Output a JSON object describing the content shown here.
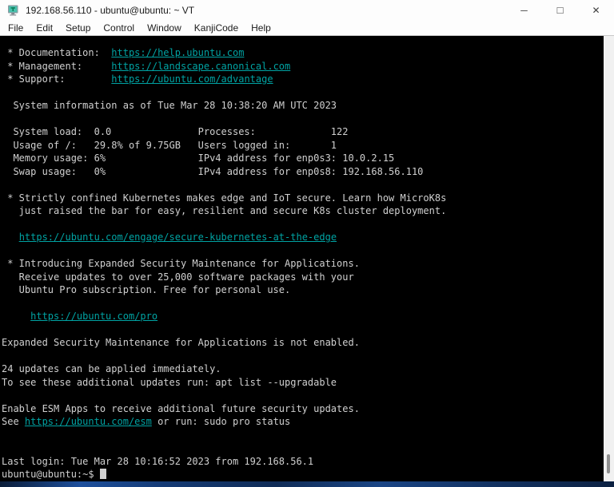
{
  "window": {
    "title": "192.168.56.110 - ubuntu@ubuntu: ~ VT",
    "app_icon": "tera-term-icon",
    "controls": [
      {
        "id": "minimize",
        "glyph": "─"
      },
      {
        "id": "maximize",
        "glyph": "□"
      },
      {
        "id": "close",
        "glyph": "✕"
      }
    ]
  },
  "menu_bar": {
    "items": [
      {
        "label": "File"
      },
      {
        "label": "Edit"
      },
      {
        "label": "Setup"
      },
      {
        "label": "Control"
      },
      {
        "label": "Window"
      },
      {
        "label": "KanjiCode"
      },
      {
        "label": "Help"
      }
    ]
  },
  "terminal": {
    "colors": {
      "background": "#000000",
      "foreground": "#d0d0d0",
      "link": "#00a3a3",
      "cursor": "#cfcfcf"
    },
    "system_info": {
      "timestamp": "Tue Mar 28 10:38:20 AM UTC 2023",
      "system_load": "0.0",
      "usage_of_root": "29.8% of 9.75GB",
      "memory_usage": "6%",
      "swap_usage": "0%",
      "processes": "122",
      "users_logged_in": "1",
      "ipv4_enp0s3": "10.0.2.15",
      "ipv4_enp0s8": "192.168.56.110"
    },
    "updates_available": "24",
    "last_login": "Tue Mar 28 10:16:52 2023 from 192.168.56.1",
    "prompt": "ubuntu@ubuntu:~$",
    "lines": [
      [
        {
          "text": " * Documentation:  ",
          "kind": "plain"
        },
        {
          "text": "https://help.ubuntu.com",
          "kind": "link"
        }
      ],
      [
        {
          "text": " * Management:     ",
          "kind": "plain"
        },
        {
          "text": "https://landscape.canonical.com",
          "kind": "link"
        }
      ],
      [
        {
          "text": " * Support:        ",
          "kind": "plain"
        },
        {
          "text": "https://ubuntu.com/advantage",
          "kind": "link"
        }
      ],
      [],
      [
        {
          "text": "  System information as of Tue Mar 28 10:38:20 AM UTC 2023",
          "kind": "plain"
        }
      ],
      [],
      [
        {
          "text": "  System load:  0.0               Processes:             122",
          "kind": "plain"
        }
      ],
      [
        {
          "text": "  Usage of /:   29.8% of 9.75GB   Users logged in:       1",
          "kind": "plain"
        }
      ],
      [
        {
          "text": "  Memory usage: 6%                IPv4 address for enp0s3: 10.0.2.15",
          "kind": "plain"
        }
      ],
      [
        {
          "text": "  Swap usage:   0%                IPv4 address for enp0s8: 192.168.56.110",
          "kind": "plain"
        }
      ],
      [],
      [
        {
          "text": " * Strictly confined Kubernetes makes edge and IoT secure. Learn how MicroK8s",
          "kind": "plain"
        }
      ],
      [
        {
          "text": "   just raised the bar for easy, resilient and secure K8s cluster deployment.",
          "kind": "plain"
        }
      ],
      [],
      [
        {
          "text": "   ",
          "kind": "plain"
        },
        {
          "text": "https://ubuntu.com/engage/secure-kubernetes-at-the-edge",
          "kind": "link"
        }
      ],
      [],
      [
        {
          "text": " * Introducing Expanded Security Maintenance for Applications.",
          "kind": "plain"
        }
      ],
      [
        {
          "text": "   Receive updates to over 25,000 software packages with your",
          "kind": "plain"
        }
      ],
      [
        {
          "text": "   Ubuntu Pro subscription. Free for personal use.",
          "kind": "plain"
        }
      ],
      [],
      [
        {
          "text": "     ",
          "kind": "plain"
        },
        {
          "text": "https://ubuntu.com/pro",
          "kind": "link"
        }
      ],
      [],
      [
        {
          "text": "Expanded Security Maintenance for Applications is not enabled.",
          "kind": "plain"
        }
      ],
      [],
      [
        {
          "text": "24 updates can be applied immediately.",
          "kind": "plain"
        }
      ],
      [
        {
          "text": "To see these additional updates run: apt list --upgradable",
          "kind": "plain"
        }
      ],
      [],
      [
        {
          "text": "Enable ESM Apps to receive additional future security updates.",
          "kind": "plain"
        }
      ],
      [
        {
          "text": "See ",
          "kind": "plain"
        },
        {
          "text": "https://ubuntu.com/esm",
          "kind": "link"
        },
        {
          "text": " or run: sudo pro status",
          "kind": "plain"
        }
      ],
      [],
      [],
      [
        {
          "text": "Last login: Tue Mar 28 10:16:52 2023 from 192.168.56.1",
          "kind": "plain"
        }
      ],
      [
        {
          "text": "ubuntu@ubuntu:~$ ",
          "kind": "plain"
        },
        {
          "kind": "cursor"
        }
      ]
    ]
  }
}
